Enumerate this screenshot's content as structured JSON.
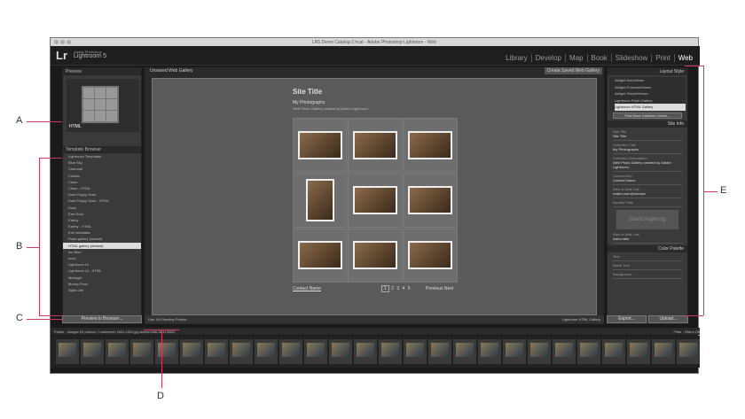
{
  "window": {
    "title": "LR5 Demo Catalog-2.lrcat - Adobe Photoshop Lightroom - Web"
  },
  "identity": {
    "mark": "Lr",
    "brand": "Adobe Photoshop",
    "product": "Lightroom 5"
  },
  "modules": [
    "Library",
    "Develop",
    "Map",
    "Book",
    "Slideshow",
    "Print",
    "Web"
  ],
  "left": {
    "preview_title": "Preview",
    "preview_label": "HTML",
    "template_title": "Template Browser",
    "templates": [
      "Lightroom Templates",
      "Blue Sky",
      "Charcoal",
      "Classic",
      "Clean",
      "Clean - HTML",
      "Dark Poppy Seed",
      "Dark Poppy Seed - HTML",
      "Dusk",
      "Earl Grey",
      "Earthy",
      "Earthy - HTML",
      "Exif metadata",
      "Flash gallery (default)",
      "HTML gallery (default)",
      "Ice Blue",
      "Ivory",
      "Lightroom UI",
      "Lightroom UI - HTML",
      "Midnight",
      "Money Rock",
      "Night Life"
    ],
    "selected_index": 14,
    "button": "Preview in Browser..."
  },
  "center": {
    "header": "Unsaved Web Gallery",
    "create": "Create Saved Web Gallery",
    "site_title": "Site Title",
    "collection": "My Photographs",
    "description": "Web Photo Gallery created by Adobe Lightroom.",
    "contact": "Contact Name",
    "pages": [
      "1",
      "2",
      "3",
      "4",
      "5"
    ],
    "prev": "Previous",
    "next": "Next",
    "toolbar_use": "Use:",
    "toolbar_value": "All Filmstrip Photos",
    "engine": "Lightroom HTML Gallery"
  },
  "right": {
    "layout_title": "Layout Style",
    "layouts": [
      "Airtight AutoViewer",
      "Airtight PostcardViewer",
      "Airtight SimpleViewer",
      "Lightroom Flash Gallery",
      "Lightroom HTML Gallery"
    ],
    "layout_selected": 4,
    "find_more": "Find More Galleries Online...",
    "siteinfo_title": "Site Info",
    "fields": [
      {
        "label": "Site Title",
        "value": "Site Title"
      },
      {
        "label": "Collection Title",
        "value": "My Photographs"
      },
      {
        "label": "Collection Description",
        "value": "Web Photo Gallery created by Adobe Lightroom."
      },
      {
        "label": "Contact Info",
        "value": "Contact Name"
      },
      {
        "label": "Web or Mail Link",
        "value": "mailto:user@domain"
      }
    ],
    "identity_plate": "Identity Plate",
    "plate_text": "David Auyeung",
    "link_label": "Web or Mail Link",
    "link_value": "index.html",
    "color_title": "Color Palette",
    "colors": [
      "Text",
      "Detail Text",
      "Background"
    ],
    "export": "Export...",
    "upload": "Upload..."
  },
  "filmstrip": {
    "folder": "Folder : Images",
    "count": "93 photos / 1 selected / IMG-1301.jpg Adobe-MAI-MI413IMG",
    "filter": "Filter :",
    "filter_value": "Filters Off"
  },
  "callouts": [
    "A",
    "B",
    "C",
    "D",
    "E"
  ]
}
